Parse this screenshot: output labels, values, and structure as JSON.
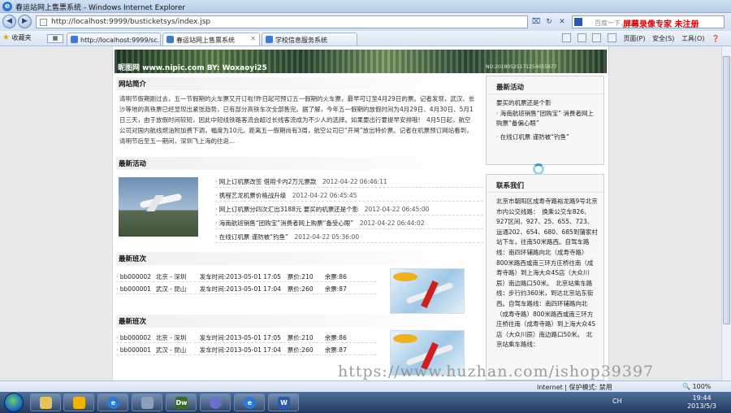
{
  "window": {
    "title": "春运站网上售票系统 - Windows Internet Explorer"
  },
  "address": {
    "url": "http://localhost:9999/busticketsys/index.jsp",
    "search_placeholder": "百度一下，你",
    "recorder_text": "屏幕录像专家 未注册"
  },
  "favorites": {
    "label": "收藏夹"
  },
  "tabs": [
    {
      "label": "http://localhost:9999/sc...",
      "active": false
    },
    {
      "label": "春运站网上售票系统",
      "active": true
    },
    {
      "label": "学校信息服务系统",
      "active": false
    }
  ],
  "toolbar": {
    "page": "页面(P)",
    "safety": "安全(S)",
    "tools": "工具(O)"
  },
  "banner": {
    "watermark_left": "昵图网 www.nipic.com   BY: Woxaoyi25",
    "watermark_right": "NO:20180525171254055977"
  },
  "intro": {
    "title": "网站简介",
    "text": "清明节假期刚过去，五一节假期的火车票又开订啦!昨日起可预订五一假期的火车票，最早可订至4月29日的票。记者发现，武汉、长沙等地的高铁票已经显现出紧张趋势，已有部分高铁车次全部售完。据了解，今年五一假期的放假时间为4月29日、4月30日、5月1日三天，由于放假时间较短，因此中短线铁路客流会超过长线客流成为不少人的选择。如果要出行要提早安排哦!　4月5日起，航空公司对国内航线燃油附加费下调，幅度为10元。距离五一假期尚有3周，航空公司已“开闸”放出特价票。记者在机票预订网站看到，清明节后至五一期间，深圳飞上海的往返..."
  },
  "news": {
    "title": "最新活动",
    "items": [
      {
        "text": "网上订机票改签 借用卡内2万元票款",
        "time": "2012-04-22 06:46:11"
      },
      {
        "text": "携程艺龙机票价格战升级",
        "time": "2012-04-22 06:45:45"
      },
      {
        "text": "网上订机票分四次汇出3188元 要买的机票还是个影",
        "time": "2012-04-22 06:45:00"
      },
      {
        "text": "海南航班销售“团购宝”消费者网上购票“备受心眼”",
        "time": "2012-04-22 06:44:02"
      },
      {
        "text": "在线订机票 谨防被“钓鱼”",
        "time": "2012-04-22 05:36:00"
      }
    ]
  },
  "trains": [
    {
      "title": "最新班次",
      "rows": [
        {
          "id": "bb000002",
          "route": "北京 - 深圳",
          "depart": "发车时间:2013-05-01 17:05",
          "price": "票价:210",
          "left": "余票:86"
        },
        {
          "id": "bb000001",
          "route": "武汉 - 昆山",
          "depart": "发车时间:2013-05-01 17:04",
          "price": "票价:260",
          "left": "余票:87"
        }
      ]
    },
    {
      "title": "最新班次",
      "rows": [
        {
          "id": "bb000002",
          "route": "北京 - 深圳",
          "depart": "发车时间:2013-05-01 17:05",
          "price": "票价:210",
          "left": "余票:86"
        },
        {
          "id": "bb000001",
          "route": "武汉 - 昆山",
          "depart": "发车时间:2013-05-01 17:04",
          "price": "票价:260",
          "left": "余票:87"
        }
      ]
    }
  ],
  "side_activity": {
    "title": "最新活动",
    "lines": [
      "要买的机票还是个影",
      "· 海南航班销售“团购宝” 消费者网上购票“备偏心眼”",
      "· 在线订机票 谨防被“钓鱼”"
    ]
  },
  "contact": {
    "title": "联系我们",
    "text": "北京市朝阳区成寿寺路裕龙路9号北京市内公交线路：　换乘公交车826、927区间、927、25、655、723、运通202、654、680、685到蒲家村站下车，往南50米路西。自驾车路线：南四环辅路向北（成寿寺路）800米路西或南三环方庄桥往南（成寿寺路）到上海大众4S店（大众川辰）南边路口50米。　北京站乘车路线：步行约360米，到达北京站东街西。自驾车路线：南四环辅路向北（成寿寺路）800米路西或南三环方庄桥往南（成寿寺路）到上海大众4S店（大众川辰）南边路口50米。　北京站乘车路线："
  },
  "watermark": "https://www.huzhan.com/ishop39397",
  "status": {
    "zone": "Internet | 保护模式: 禁用",
    "zoom": "100%"
  },
  "taskbar": {
    "apps": [
      "folder",
      "sticky",
      "ie",
      "tools",
      "dw",
      "media",
      "ie2",
      "word"
    ],
    "time": "19:44",
    "date": "2013/5/3",
    "lang": "CH"
  }
}
